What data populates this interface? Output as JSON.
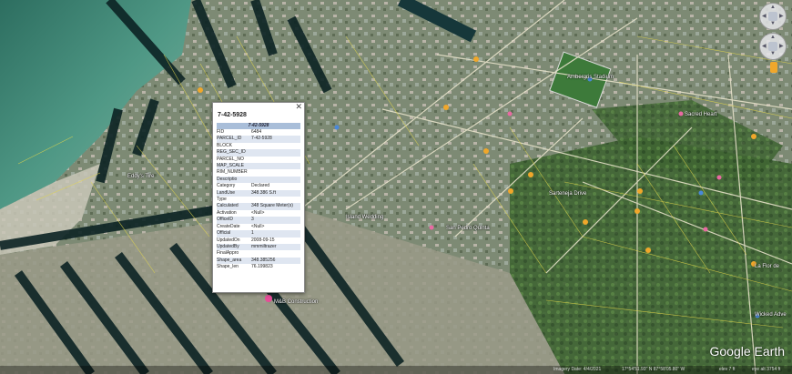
{
  "popup": {
    "title": "7-42-5928",
    "header": "7-42-5928",
    "close_icon": "close-icon",
    "rows": [
      {
        "key": "FID",
        "value": "6484"
      },
      {
        "key": "PARCEL_ID",
        "value": "7-42-5928"
      },
      {
        "key": "BLOCK",
        "value": ""
      },
      {
        "key": "REG_SEC_ID",
        "value": ""
      },
      {
        "key": "PARCEL_NO",
        "value": ""
      },
      {
        "key": "MAP_SCALE",
        "value": ""
      },
      {
        "key": "RIM_NUMBER",
        "value": ""
      },
      {
        "key": "Descriptio",
        "value": ""
      },
      {
        "key": "Category",
        "value": "Declared"
      },
      {
        "key": "LandUse",
        "value": "348.386 S.ft"
      },
      {
        "key": "Type",
        "value": ""
      },
      {
        "key": "Calculated",
        "value": "348 Square Meter(s)"
      },
      {
        "key": "Activation",
        "value": "<Null>"
      },
      {
        "key": "OfficeID",
        "value": "3"
      },
      {
        "key": "CreateDate",
        "value": "<Null>"
      },
      {
        "key": "Official",
        "value": "1"
      },
      {
        "key": "UpdatedOn",
        "value": "2008-09-15"
      },
      {
        "key": "UpdatedBy",
        "value": "mmmiltrazer"
      },
      {
        "key": "FinalAppro",
        "value": ""
      },
      {
        "key": "Shape_area",
        "value": "348.385256"
      },
      {
        "key": "Shape_len",
        "value": "76.199823"
      }
    ]
  },
  "map_labels": {
    "stadium": "Ambergris Stadium",
    "boca": "Isla Bonita Veterinary",
    "saca": "Sarteneja Drive",
    "wicked": "Wicked Adve",
    "laflor": "La Flor de",
    "island": "Island Wedding",
    "eddys": "Eddy's Tire",
    "mbb": "M&B Construction",
    "sbp": "San Pedro Quinta",
    "sacred": "Sacred Heart"
  },
  "status": {
    "imagery_date": "Imagery Date: 4/4/2021",
    "coords": "17°54'51.93\" N   87°58'05.80\" W",
    "elev": "elev  7 ft",
    "eye": "eye alt  3754 ft"
  },
  "logo": "Google Earth",
  "controls": {
    "look": "look-control",
    "move": "move-control"
  }
}
